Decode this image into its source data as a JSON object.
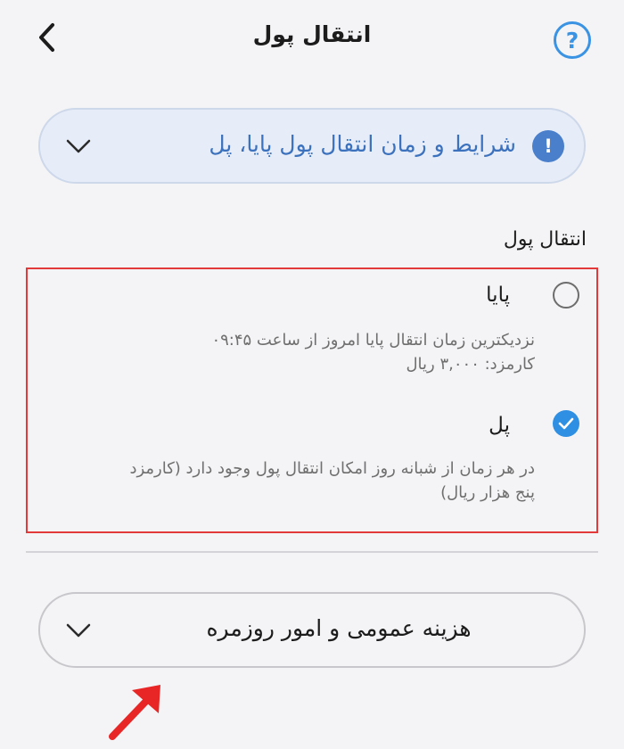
{
  "header": {
    "title": "انتقال پول",
    "back_icon": "chevron-left-icon",
    "help_icon": "question-circle-icon",
    "help_glyph": "?",
    "accent_color": "#3b93e4"
  },
  "notice": {
    "text": "شرایط و زمان انتقال پول پایا، پل",
    "icon": "exclamation-circle-icon",
    "icon_glyph": "!",
    "background_color": "#e7edf8",
    "text_color": "#3c72bd"
  },
  "section": {
    "title": "انتقال پول"
  },
  "options": [
    {
      "title": "پایا",
      "description_line1": "نزدیکترین زمان انتقال پایا امروز از ساعت ۰۹:۴۵",
      "description_line2": "کارمزد: ۳,۰۰۰ ریال",
      "selected": false
    },
    {
      "title": "پل",
      "description_line1": "در هر زمان از شبانه روز امکان انتقال پول وجود دارد (کارمزد",
      "description_line2": "پنج هزار ریال)",
      "selected": true
    }
  ],
  "category": {
    "text": "هزینه عمومی و امور روزمره"
  },
  "colors": {
    "background": "#f4f4f6",
    "radio_checked": "#2f8fe2",
    "highlight_border": "#e23a3a",
    "annotation_arrow": "#e82626"
  }
}
